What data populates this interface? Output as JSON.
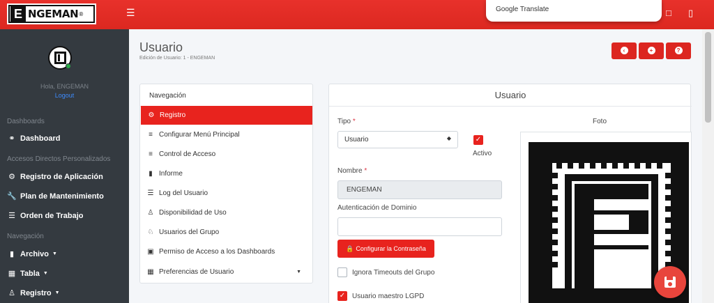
{
  "brand": {
    "logo_text": "NGEMAN",
    "logo_mark": "E",
    "logo_suffix": "®"
  },
  "translate_popup": {
    "label": "Google Translate"
  },
  "sidebar": {
    "hello": "Hola, ENGEMAN",
    "logout": "Logout",
    "sections": [
      {
        "header": "Dashboards",
        "items": [
          {
            "label": "Dashboard",
            "icon": "dashboard-icon"
          }
        ]
      },
      {
        "header": "Accesos Directos Personalizados",
        "items": [
          {
            "label": "Registro de Aplicación",
            "icon": "gears-icon"
          },
          {
            "label": "Plan de Mantenimiento",
            "icon": "wrench-icon"
          },
          {
            "label": "Orden de Trabajo",
            "icon": "list-icon"
          }
        ]
      },
      {
        "header": "Navegación",
        "items": [
          {
            "label": "Archivo",
            "icon": "file-icon"
          },
          {
            "label": "Tabla",
            "icon": "table-icon"
          },
          {
            "label": "Registro",
            "icon": "user-plus-icon"
          }
        ]
      }
    ]
  },
  "page": {
    "title": "Usuario",
    "subtitle": "Edición de Usuario: 1 - ENGEMAN"
  },
  "header_buttons": [
    {
      "name": "back-button",
      "icon": "arrow-left-icon"
    },
    {
      "name": "new-button",
      "icon": "plus-icon"
    },
    {
      "name": "help-button",
      "icon": "question-icon"
    }
  ],
  "nav_card": {
    "title": "Navegación",
    "items": [
      {
        "label": "Registro",
        "icon": "gears-icon",
        "active": true
      },
      {
        "label": "Configurar Menú Principal",
        "icon": "align-left-icon"
      },
      {
        "label": "Control de Acceso",
        "icon": "indent-icon"
      },
      {
        "label": "Informe",
        "icon": "file-icon"
      },
      {
        "label": "Log del Usuario",
        "icon": "list-icon"
      },
      {
        "label": "Disponibilidad de Uso",
        "icon": "user-clock-icon"
      },
      {
        "label": "Usuarios del Grupo",
        "icon": "users-icon"
      },
      {
        "label": "Permiso de Acceso a los Dashboards",
        "icon": "window-icon"
      },
      {
        "label": "Preferencias de Usuario",
        "icon": "sitemap-icon"
      }
    ]
  },
  "user_form": {
    "title": "Usuario",
    "tipo_label": "Tipo",
    "tipo_value": "Usuario",
    "activo_label": "Activo",
    "activo_checked": true,
    "nombre_label": "Nombre",
    "nombre_value": "ENGEMAN",
    "auth_label": "Autenticación de Dominio",
    "auth_value": "",
    "password_button": "Configurar la Contraseña",
    "ignora_label": "Ignora Timeouts del Grupo",
    "ignora_checked": false,
    "lgpd_label": "Usuario maestro LGPD",
    "lgpd_checked": true,
    "foto_label": "Foto",
    "required_mark": "*"
  },
  "colors": {
    "primary": "#e8231e",
    "sidebar_bg": "#343a40",
    "link": "#3d8bfd"
  }
}
